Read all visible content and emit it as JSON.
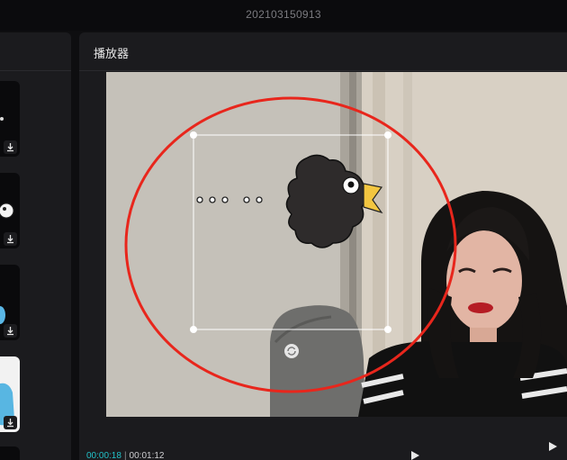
{
  "window": {
    "title": "202103150913"
  },
  "player": {
    "title": "播放器",
    "time_current": "00:00:18",
    "time_separator": "|",
    "time_total": "00:01:12"
  },
  "icons": {
    "play": "play-icon",
    "fullscreen": "fullscreen-play-icon",
    "download": "download-icon",
    "rotate": "rotate-icon"
  },
  "colors": {
    "accent": "#22c1c8",
    "annotation_circle": "#e8261c",
    "panel": "#1b1b1e"
  }
}
